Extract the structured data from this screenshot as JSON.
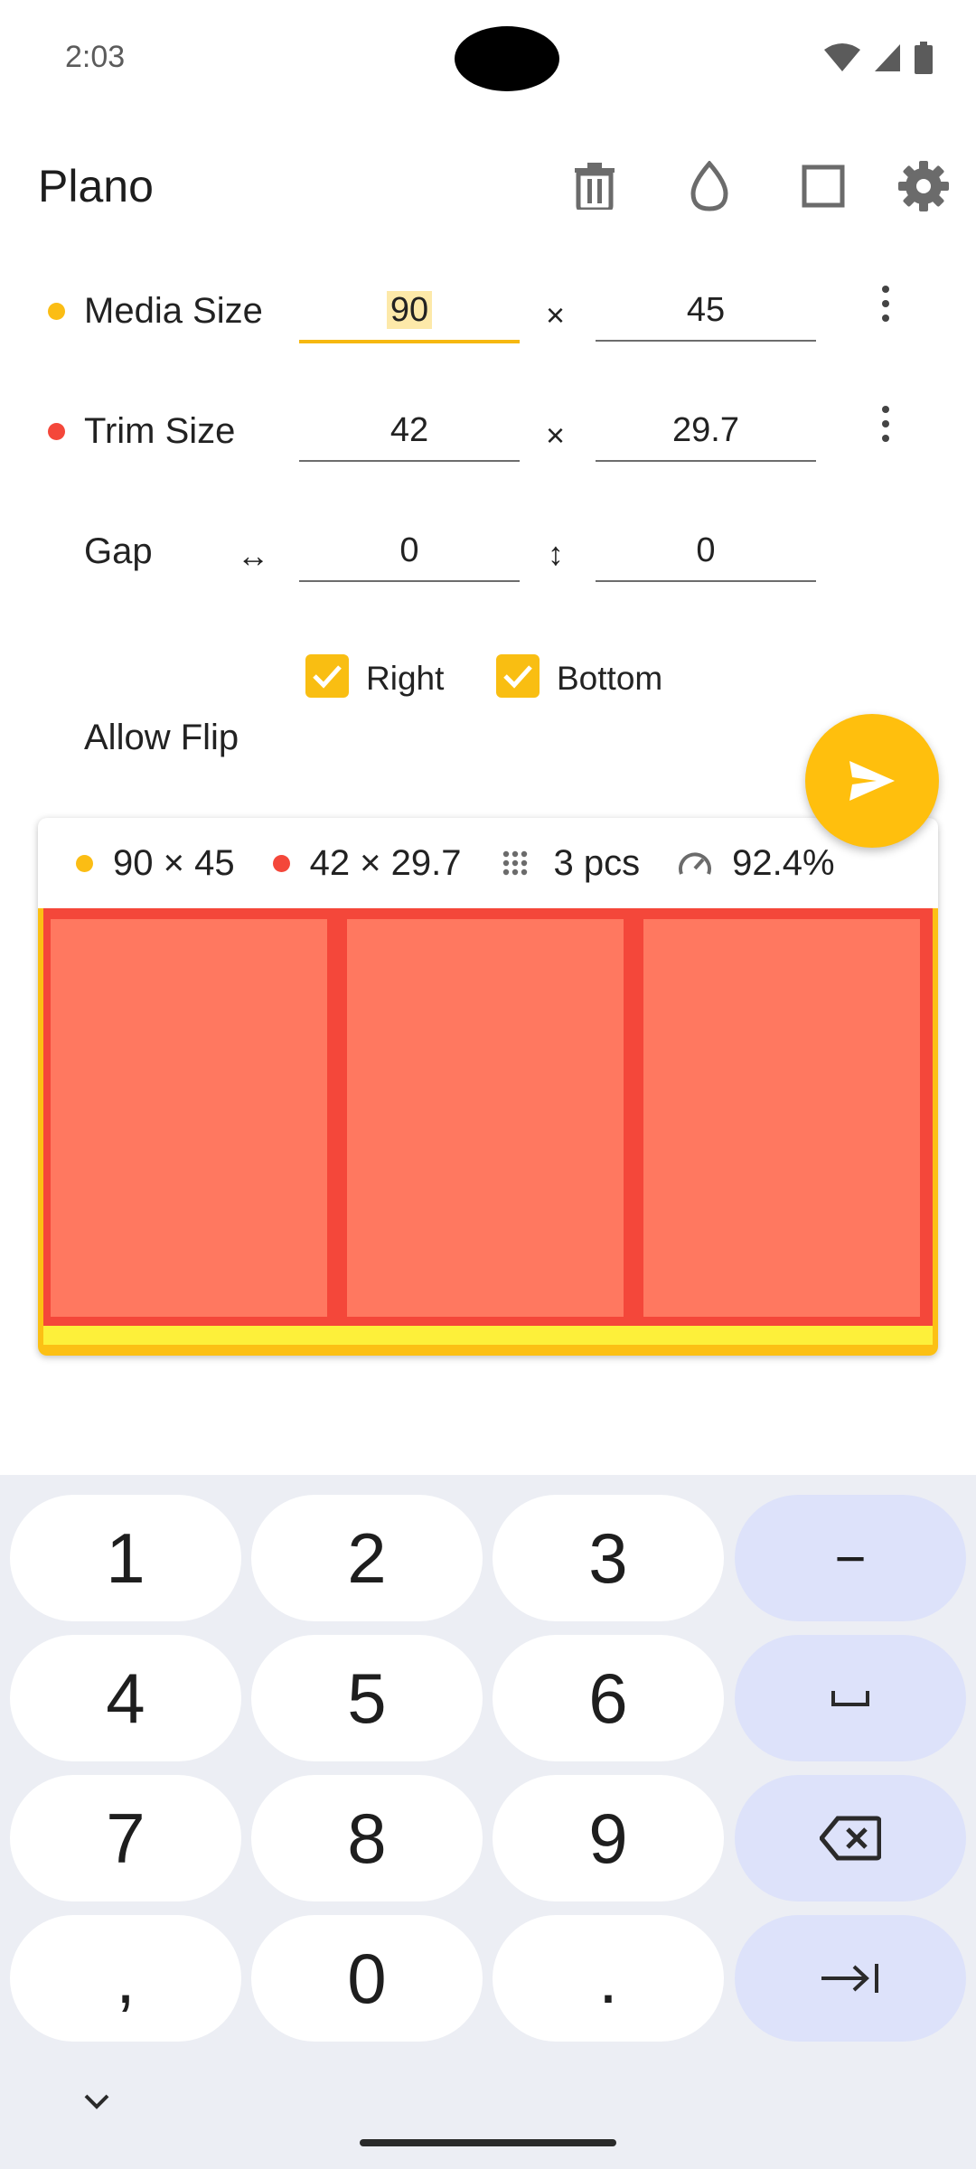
{
  "status": {
    "time": "2:03"
  },
  "app": {
    "title": "Plano"
  },
  "media": {
    "label": "Media Size",
    "width": "90",
    "height": "45",
    "color": "#fbbd14"
  },
  "trim": {
    "label": "Trim Size",
    "width": "42",
    "height": "29.7",
    "color": "#f4473a"
  },
  "gap": {
    "label": "Gap",
    "h_icon": "↔",
    "v_icon": "↕",
    "horizontal": "0",
    "vertical": "0"
  },
  "times": "×",
  "flip": {
    "label": "Allow Flip",
    "right_label": "Right",
    "bottom_label": "Bottom",
    "right_checked": true,
    "bottom_checked": true
  },
  "summary": {
    "media": "90 × 45",
    "trim": "42 × 29.7",
    "pieces": "3 pcs",
    "efficiency": "92.4%"
  },
  "keyboard": {
    "rows": [
      [
        "1",
        "2",
        "3",
        "−"
      ],
      [
        "4",
        "5",
        "6",
        "␣"
      ],
      [
        "7",
        "8",
        "9",
        "backspace"
      ],
      [
        ",",
        "0",
        ".",
        "tab"
      ]
    ]
  },
  "icons": [
    "delete-icon",
    "drop-icon",
    "square-icon",
    "settings-icon",
    "send-icon",
    "grid-icon",
    "speedometer-icon",
    "wifi-icon",
    "signal-icon",
    "battery-icon",
    "chevron-down-icon"
  ]
}
